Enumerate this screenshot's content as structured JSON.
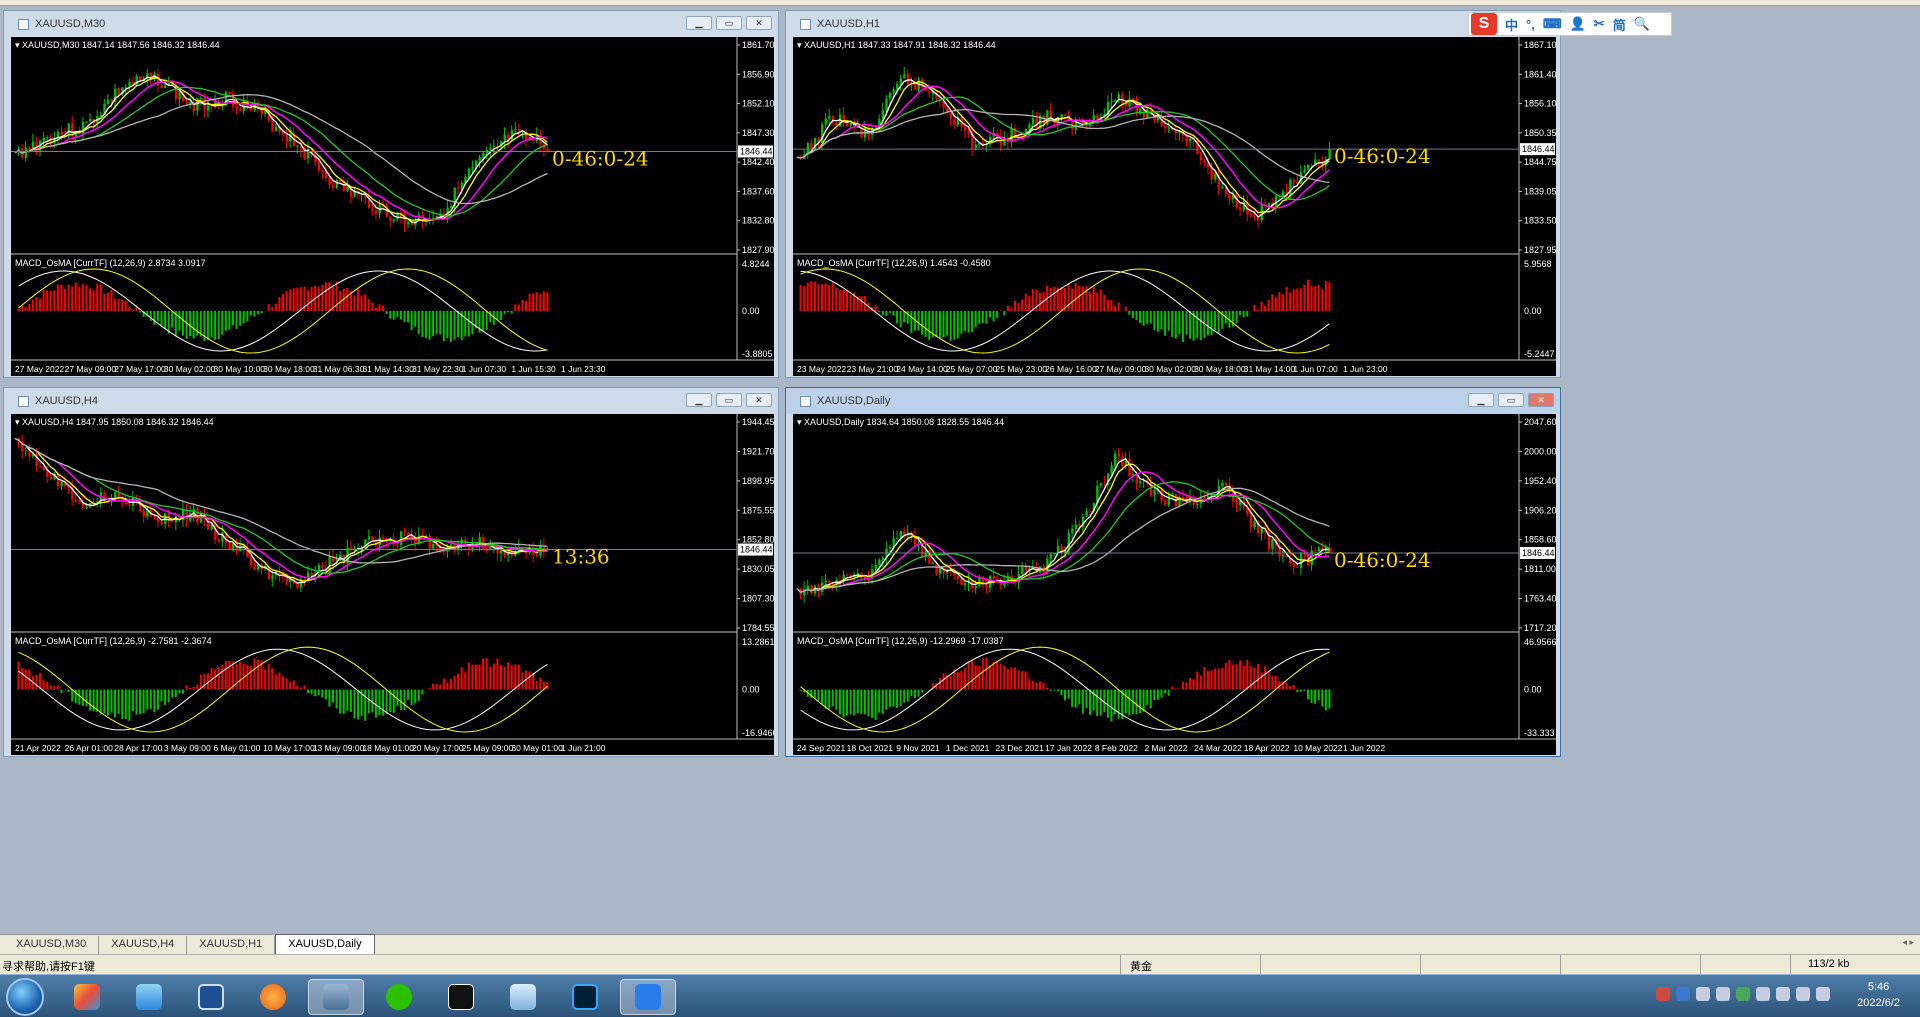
{
  "toolbar_strip": "",
  "ime": {
    "logo": "S",
    "items": [
      "中",
      "°,",
      "⌨",
      "👤",
      "✂",
      "简",
      "🔍"
    ]
  },
  "windows": [
    {
      "id": "m30",
      "title": "XAUUSD,M30",
      "ohlc": "XAUUSD,M30  1847.14 1847.56 1846.32 1846.44",
      "price_ticks": [
        "1861.70",
        "1856.90",
        "1852.10",
        "1847.30",
        "1842.40",
        "1837.60",
        "1832.80",
        "1827.90"
      ],
      "current_price": "1846.44",
      "countdown": "0-46:0-24",
      "indicator": "MACD_OsMA [CurrTF] (12,26,9) 2.8734 3.0917",
      "ind_ticks": [
        "4.8244",
        "0.00",
        "-3.8805"
      ],
      "time_ticks": [
        "27 May 2022",
        "27 May 09:00",
        "27 May 17:00",
        "30 May 02:00",
        "30 May 10:00",
        "30 May 18:00",
        "31 May 06:30",
        "31 May 14:30",
        "31 May 22:30",
        "1 Jun 07:30",
        "1 Jun 15:30",
        "1 Jun 23:30"
      ]
    },
    {
      "id": "h1",
      "title": "XAUUSD,H1",
      "ohlc": "XAUUSD,H1  1847.33 1847.91 1846.32 1846.44",
      "price_ticks": [
        "1867.10",
        "1861.40",
        "1856.10",
        "1850.35",
        "1844.75",
        "1839.05",
        "1833.50",
        "1827.95"
      ],
      "current_price": "1846.44",
      "countdown": "0-46:0-24",
      "indicator": "MACD_OsMA [CurrTF] (12,26,9) 1.4543 -0.4580",
      "ind_ticks": [
        "5.9568",
        "0.00",
        "-5.2447"
      ],
      "time_ticks": [
        "23 May 2022",
        "23 May 21:00",
        "24 May 14:00",
        "25 May 07:00",
        "25 May 23:00",
        "26 May 16:00",
        "27 May 09:00",
        "30 May 02:00",
        "30 May 18:00",
        "31 May 14:00",
        "1 Jun 07:00",
        "1 Jun 23:00"
      ]
    },
    {
      "id": "h4",
      "title": "XAUUSD,H4",
      "ohlc": "XAUUSD,H4  1847.95 1850.08 1846.32 1846.44",
      "price_ticks": [
        "1944.45",
        "1921.70",
        "1898.95",
        "1875.55",
        "1852.80",
        "1830.05",
        "1807.30",
        "1784.55"
      ],
      "current_price": "1846.44",
      "countdown": "13:36",
      "indicator": "MACD_OsMA [CurrTF] (12,26,9) -2.7581 -2.3674",
      "ind_ticks": [
        "13.2861",
        "0.00",
        "-16.9466"
      ],
      "time_ticks": [
        "21 Apr 2022",
        "26 Apr 01:00",
        "28 Apr 17:00",
        "3 May 09:00",
        "6 May 01:00",
        "10 May 17:00",
        "13 May 09:00",
        "18 May 01:00",
        "20 May 17:00",
        "25 May 09:00",
        "30 May 01:00",
        "1 Jun 21:00"
      ]
    },
    {
      "id": "d1",
      "title": "XAUUSD,Daily",
      "ohlc": "XAUUSD,Daily  1834.64 1850.08 1828.55 1846.44",
      "price_ticks": [
        "2047.60",
        "2000.00",
        "1952.40",
        "1906.20",
        "1858.60",
        "1811.00",
        "1763.40",
        "1717.20"
      ],
      "current_price": "1846.44",
      "countdown": "0-46:0-24",
      "indicator": "MACD_OsMA [CurrTF] (12,26,9) -12.2969 -17.0387",
      "ind_ticks": [
        "46.9566",
        "0.00",
        "-33.333"
      ],
      "time_ticks": [
        "24 Sep 2021",
        "18 Oct 2021",
        "9 Nov 2021",
        "1 Dec 2021",
        "23 Dec 2021",
        "17 Jan 2022",
        "8 Feb 2022",
        "2 Mar 2022",
        "24 Mar 2022",
        "18 Apr 2022",
        "10 May 2022",
        "1 Jun 2022"
      ]
    }
  ],
  "tabs": [
    "XAUUSD,M30",
    "XAUUSD,H4",
    "XAUUSD,H1",
    "XAUUSD,Daily"
  ],
  "status": {
    "help": "寻求帮助,请按F1键",
    "instrument": "黄金",
    "traffic": "113/2 kb"
  },
  "clock": {
    "time": "5:46",
    "date": "2022/6/2"
  },
  "colors": {
    "bull": "#00c000",
    "bear": "#ff0000",
    "ma_fast": "#ffffff",
    "ma_yellow": "#ffff00",
    "ma_magenta": "#ff00ff",
    "ma_green": "#22c822",
    "ma_gray": "#b4b4b4",
    "macd_up": "#ff0000",
    "macd_down": "#00c000",
    "countdown": "#ffd700"
  }
}
